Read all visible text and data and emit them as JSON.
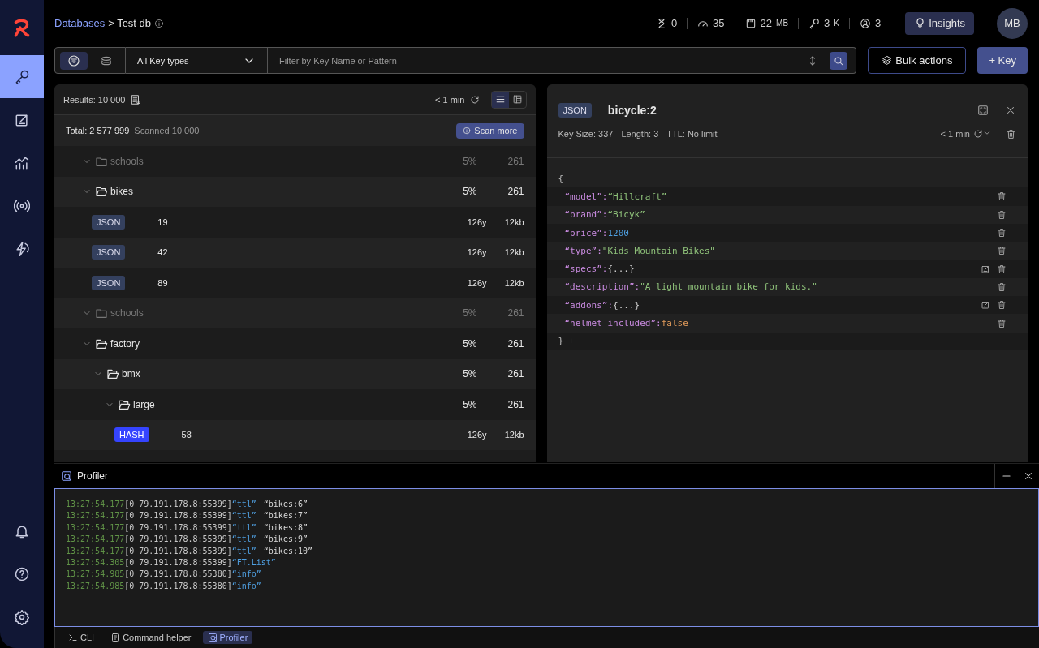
{
  "breadcrumb": {
    "link": "Databases",
    "current": "> Test db"
  },
  "stats": [
    {
      "kind": "commands",
      "value": "0"
    },
    {
      "kind": "speed",
      "value": "35"
    },
    {
      "kind": "memory",
      "value": "22",
      "unit": "MB"
    },
    {
      "kind": "keys",
      "value": "3",
      "unit": "K"
    },
    {
      "kind": "clients",
      "value": "3"
    }
  ],
  "insights_button": "Insights",
  "avatar": "MB",
  "sidebar": {
    "items": [
      {
        "kind": "browser",
        "selected": true
      },
      {
        "kind": "workbench",
        "selected": false
      },
      {
        "kind": "analysis",
        "selected": false
      },
      {
        "kind": "pubsub",
        "selected": false
      },
      {
        "kind": "triggers",
        "selected": false
      }
    ],
    "bottom": [
      {
        "kind": "notifications"
      },
      {
        "kind": "help"
      },
      {
        "kind": "settings"
      }
    ]
  },
  "filter": {
    "modes": [
      {
        "kind": "filter",
        "selected": true
      },
      {
        "kind": "search",
        "selected": false
      }
    ],
    "key_type": "All Key types",
    "placeholder": "Filter by Key Name or Pattern"
  },
  "bulk_actions_button": "Bulk actions",
  "add_key_button": "+ Key",
  "key_list": {
    "results": "Results: 10 000",
    "refreshed": "< 1 min",
    "views": [
      {
        "kind": "list",
        "selected": true
      },
      {
        "kind": "tree",
        "selected": false
      }
    ],
    "total": "Total: 2 577 999",
    "scanned": "Scanned 10 000",
    "scan_more_button": "Scan more",
    "tree": [
      {
        "kind": "folder",
        "name": "schools",
        "expanded": true,
        "dimmed": true,
        "share": "5%",
        "count": "261"
      },
      {
        "kind": "folder",
        "name": "bikes",
        "expanded": true,
        "dimmed": false,
        "share": "5%",
        "count": "261",
        "children": [
          {
            "kind": "key",
            "type": "JSON",
            "name": "19",
            "ttl": "126y",
            "size": "12kb"
          },
          {
            "kind": "key",
            "type": "JSON",
            "name": "42",
            "ttl": "126y",
            "size": "12kb"
          },
          {
            "kind": "key",
            "type": "JSON",
            "name": "89",
            "ttl": "126y",
            "size": "12kb"
          }
        ]
      },
      {
        "kind": "folder",
        "name": "schools",
        "expanded": true,
        "dimmed": true,
        "share": "5%",
        "count": "261"
      },
      {
        "kind": "folder",
        "name": "factory",
        "expanded": true,
        "dimmed": false,
        "share": "5%",
        "count": "261",
        "children": [
          {
            "kind": "folder",
            "name": "bmx",
            "expanded": true,
            "dimmed": false,
            "share": "5%",
            "count": "261",
            "children": [
              {
                "kind": "folder",
                "name": "large",
                "expanded": true,
                "dimmed": false,
                "share": "5%",
                "count": "261",
                "children": [
                  {
                    "kind": "key",
                    "type": "HASH",
                    "name": "58",
                    "ttl": "126y",
                    "size": "12kb"
                  }
                ]
              }
            ]
          }
        ]
      }
    ]
  },
  "key_details": {
    "type": "JSON",
    "name": "bicycle:2",
    "key_size": "Key Size: 337",
    "length": "Length: 3",
    "ttl": "TTL: No limit",
    "refreshed": "< 1 min",
    "open_brace": "{",
    "close_brace": "}",
    "add": "+",
    "fields": [
      {
        "key": "“model”:",
        "value": "“Hillcraft”",
        "kind": "string",
        "editable": false
      },
      {
        "key": "“brand”:",
        "value": "“Bicyk”",
        "kind": "string",
        "editable": false
      },
      {
        "key": "“price”:",
        "value": "1200",
        "kind": "number",
        "editable": false
      },
      {
        "key": "“type”:",
        "value": "\"Kids Mountain Bikes\"",
        "kind": "string",
        "editable": false
      },
      {
        "key": "“specs”:",
        "value": "{...}",
        "kind": "object",
        "editable": true
      },
      {
        "key": "“description”:",
        "value": "\"A light mountain bike for kids.\"",
        "kind": "string",
        "editable": false
      },
      {
        "key": "“addons”:",
        "value": "{...}",
        "kind": "object",
        "editable": true
      },
      {
        "key": "“helmet_included”:",
        "value": "false",
        "kind": "boolean",
        "editable": false
      }
    ]
  },
  "profiler": {
    "title": "Profiler",
    "lines": [
      {
        "time": "13:27:54.177",
        "client": "[0 79.191.178.8:55399]",
        "command": "“ttl”",
        "argument": "“bikes:6”"
      },
      {
        "time": "13:27:54.177",
        "client": "[0 79.191.178.8:55399]",
        "command": "“ttl”",
        "argument": "“bikes:7”"
      },
      {
        "time": "13:27:54.177",
        "client": "[0 79.191.178.8:55399]",
        "command": "“ttl”",
        "argument": "“bikes:8”"
      },
      {
        "time": "13:27:54.177",
        "client": "[0 79.191.178.8:55399]",
        "command": "“ttl”",
        "argument": "“bikes:9”"
      },
      {
        "time": "13:27:54.177",
        "client": "[0 79.191.178.8:55399]",
        "command": "“ttl”",
        "argument": "“bikes:10”"
      },
      {
        "time": "13:27:54.305",
        "client": "[0 79.191.178.8:55399]",
        "command": "“FT.List”"
      },
      {
        "time": "13:27:54.985",
        "client": "[0 79.191.178.8:55380]",
        "command": "“info”"
      },
      {
        "time": "13:27:54.985",
        "client": "[0 79.191.178.8:55380]",
        "command": "“info”"
      }
    ]
  },
  "bottom_tabs": [
    {
      "kind": "cli",
      "label": "CLI",
      "selected": false
    },
    {
      "kind": "helper",
      "label": "Command helper",
      "selected": false
    },
    {
      "kind": "profiler",
      "label": "Profiler",
      "selected": true
    }
  ]
}
